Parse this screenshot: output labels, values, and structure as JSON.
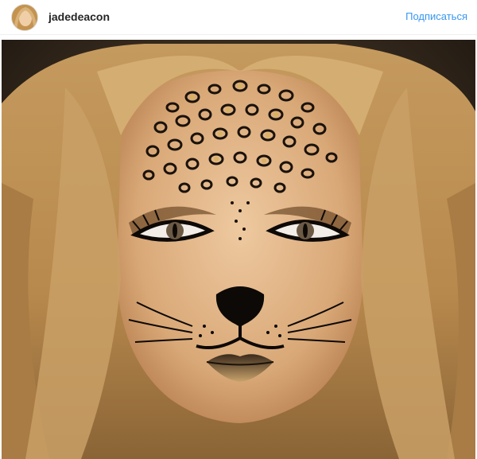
{
  "post": {
    "username": "jadedeacon",
    "follow_label": "Подписаться",
    "colors": {
      "follow": "#3897f0",
      "username": "#262626",
      "divider": "#efefef"
    }
  },
  "icons": {
    "avatar": "profile-photo"
  }
}
